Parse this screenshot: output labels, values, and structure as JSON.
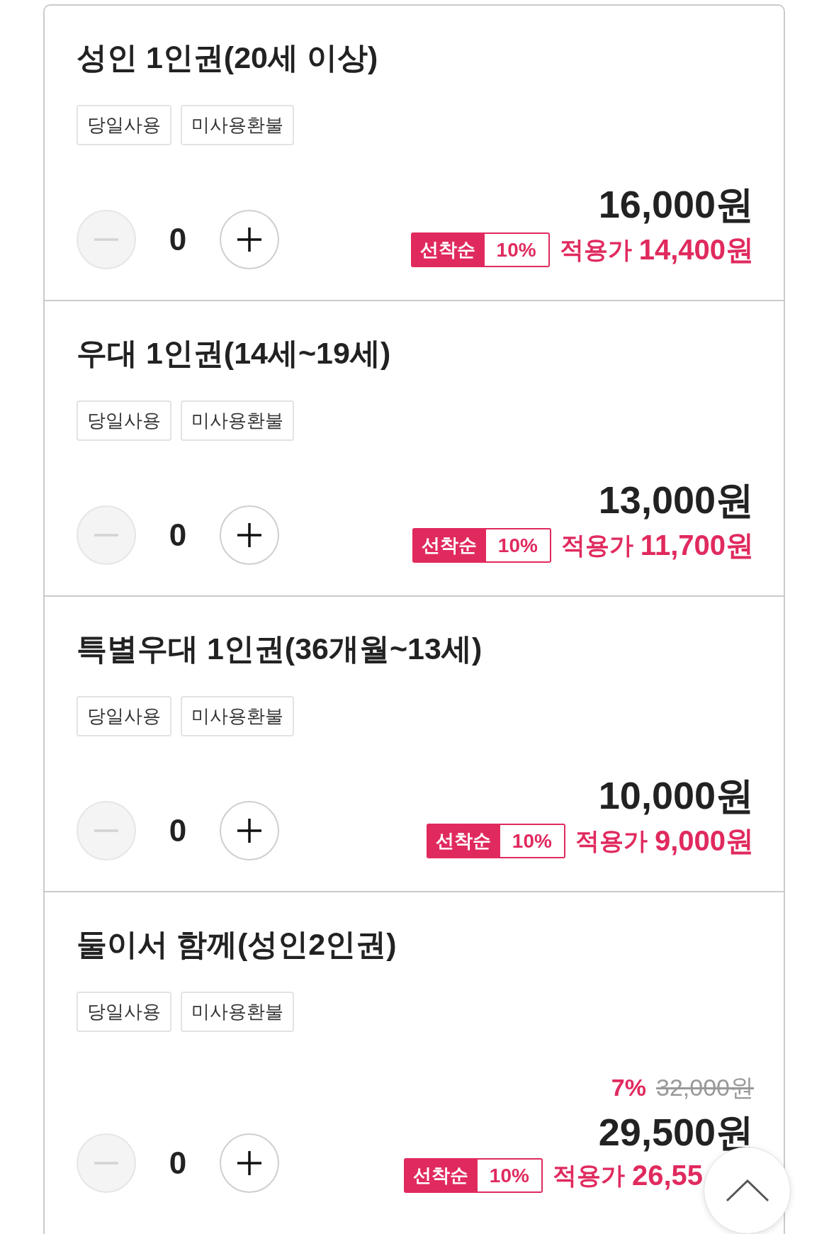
{
  "tickets": [
    {
      "title": "성인 1인권(20세 이상)",
      "tags": [
        "당일사용",
        "미사용환불"
      ],
      "quantity": "0",
      "decrease_disabled": true,
      "price": "16,000원",
      "promo": {
        "label": "선착순",
        "rate": "10%"
      },
      "applied_label": "적용가",
      "applied_price": "14,400원"
    },
    {
      "title": "우대 1인권(14세~19세)",
      "tags": [
        "당일사용",
        "미사용환불"
      ],
      "quantity": "0",
      "decrease_disabled": true,
      "price": "13,000원",
      "promo": {
        "label": "선착순",
        "rate": "10%"
      },
      "applied_label": "적용가",
      "applied_price": "11,700원"
    },
    {
      "title": "특별우대 1인권(36개월~13세)",
      "tags": [
        "당일사용",
        "미사용환불"
      ],
      "quantity": "0",
      "decrease_disabled": true,
      "price": "10,000원",
      "promo": {
        "label": "선착순",
        "rate": "10%"
      },
      "applied_label": "적용가",
      "applied_price": "9,000원"
    },
    {
      "title": "둘이서 함께(성인2인권)",
      "tags": [
        "당일사용",
        "미사용환불"
      ],
      "quantity": "0",
      "decrease_disabled": true,
      "discount": {
        "rate": "7%",
        "original_price": "32,000원"
      },
      "price": "29,500원",
      "promo": {
        "label": "선착순",
        "rate": "10%"
      },
      "applied_label": "적용가",
      "applied_price": "26,55"
    }
  ]
}
